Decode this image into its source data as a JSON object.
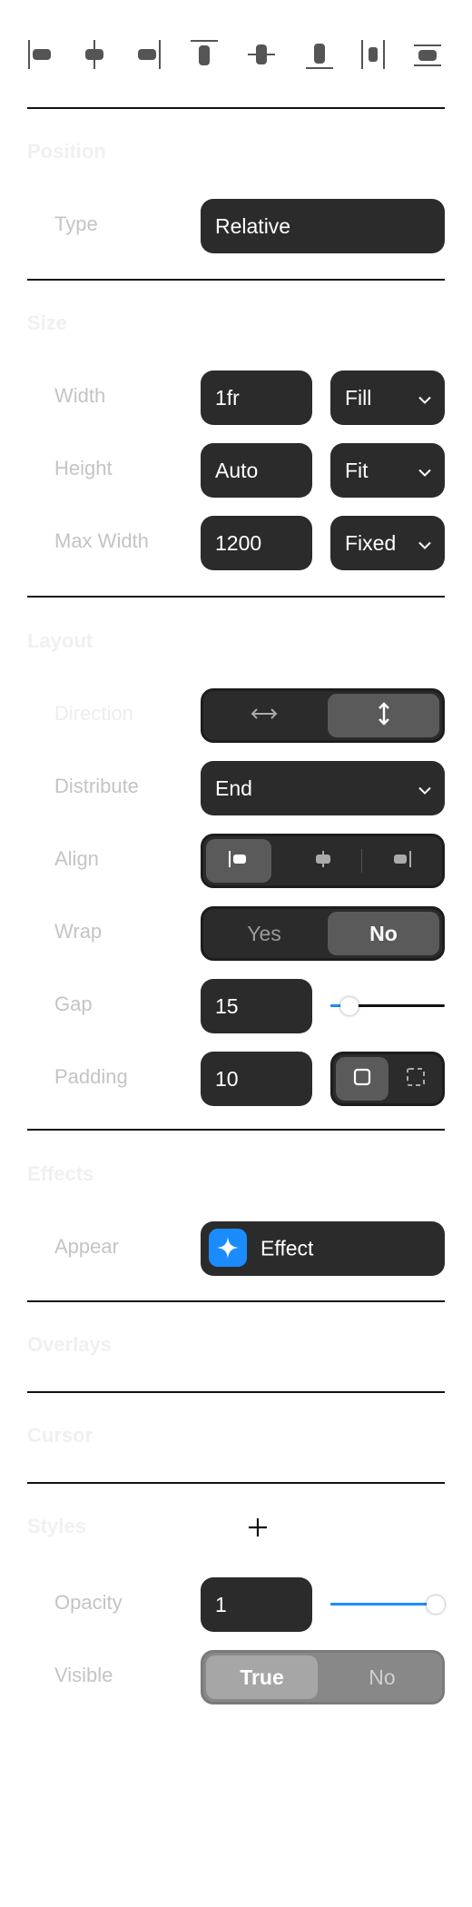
{
  "alignment_icons": [
    "align-left-icon",
    "align-center-horizontal-icon",
    "align-right-icon",
    "align-top-icon",
    "align-center-vertical-icon",
    "align-bottom-icon",
    "distribute-horizontal-icon",
    "distribute-vertical-icon"
  ],
  "position": {
    "title": "Position",
    "type_label": "Type",
    "type_value": "Relative"
  },
  "size": {
    "title": "Size",
    "width_label": "Width",
    "width_value": "1fr",
    "width_mode": "Fill",
    "height_label": "Height",
    "height_value": "Auto",
    "height_mode": "Fit",
    "maxwidth_label": "Max Width",
    "maxwidth_value": "1200",
    "maxwidth_mode": "Fixed"
  },
  "layout": {
    "title": "Layout",
    "direction_label": "Direction",
    "direction_selected": "vertical",
    "distribute_label": "Distribute",
    "distribute_value": "End",
    "align_label": "Align",
    "align_selected": "start",
    "wrap_label": "Wrap",
    "wrap_yes": "Yes",
    "wrap_no": "No",
    "wrap_selected": "No",
    "gap_label": "Gap",
    "gap_value": "15",
    "gap_slider_fraction": 0.1,
    "padding_label": "Padding",
    "padding_value": "10",
    "padding_mode": "uniform"
  },
  "effects": {
    "title": "Effects",
    "appear_label": "Appear",
    "effect_button": "Effect",
    "effect_icon_color": "#1a8cff"
  },
  "overlays": {
    "title": "Overlays"
  },
  "cursor": {
    "title": "Cursor"
  },
  "styles": {
    "title": "Styles",
    "add_icon": "plus-icon",
    "opacity_label": "Opacity",
    "opacity_value": "1",
    "opacity_slider_fraction": 1.0,
    "visible_label": "Visible",
    "visible_true": "True",
    "visible_no": "No",
    "visible_selected": "True"
  },
  "colors": {
    "accent": "#1a8cff",
    "control_bg": "#2b2b2b",
    "label": "#c4c4c4"
  }
}
